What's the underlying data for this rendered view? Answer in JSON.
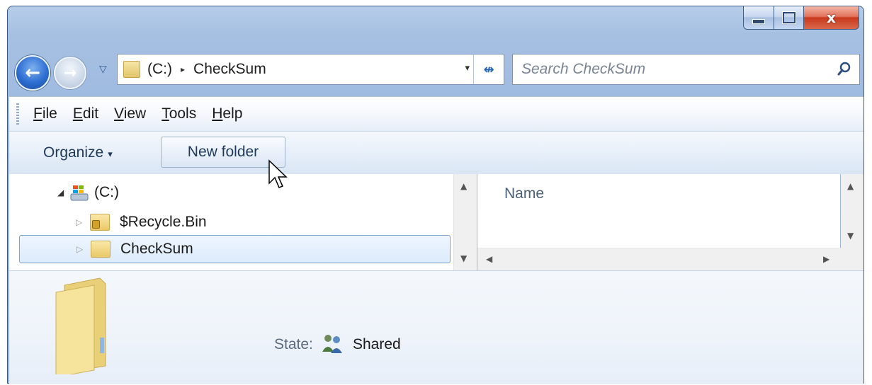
{
  "window": {
    "controls": {
      "minimize": "minimize",
      "maximize": "maximize",
      "close": "x"
    }
  },
  "navigation": {
    "back_glyph": "←",
    "forward_glyph": "→",
    "recent_glyph": "▽"
  },
  "address_bar": {
    "root": "(C:)",
    "separator": "▸",
    "current": "CheckSum",
    "dropdown_glyph": "▾",
    "refresh_glyph": "↮"
  },
  "search": {
    "placeholder": "Search CheckSum",
    "icon": "search-icon"
  },
  "menu": {
    "items": [
      {
        "label": "File",
        "accel": "F",
        "rest": "ile"
      },
      {
        "label": "Edit",
        "accel": "E",
        "rest": "dit"
      },
      {
        "label": "View",
        "accel": "V",
        "rest": "iew"
      },
      {
        "label": "Tools",
        "accel": "T",
        "rest": "ools"
      },
      {
        "label": "Help",
        "accel": "H",
        "rest": "elp"
      }
    ]
  },
  "toolbar": {
    "organize_label": "Organize",
    "organize_caret": "▾",
    "new_folder_label": "New folder"
  },
  "tree": {
    "items": [
      {
        "label": "(C:)",
        "expander": "◢",
        "icon": "drive-icon"
      },
      {
        "label": "$Recycle.Bin",
        "expander": "▷",
        "icon": "locked-folder-icon"
      },
      {
        "label": "CheckSum",
        "expander": "▷",
        "icon": "folder-icon",
        "selected": true
      }
    ]
  },
  "content": {
    "column_header": "Name"
  },
  "scrollbars": {
    "up": "▲",
    "down": "▼",
    "left": "◀",
    "right": "▶"
  },
  "details": {
    "state_label": "State:",
    "state_value": "Shared",
    "icon": "shared-users-icon"
  },
  "colors": {
    "frame": "#a6c0e2",
    "close_button": "#c8391c",
    "selection_border": "#7da2ce",
    "selection_fill": "#dcebfc"
  }
}
